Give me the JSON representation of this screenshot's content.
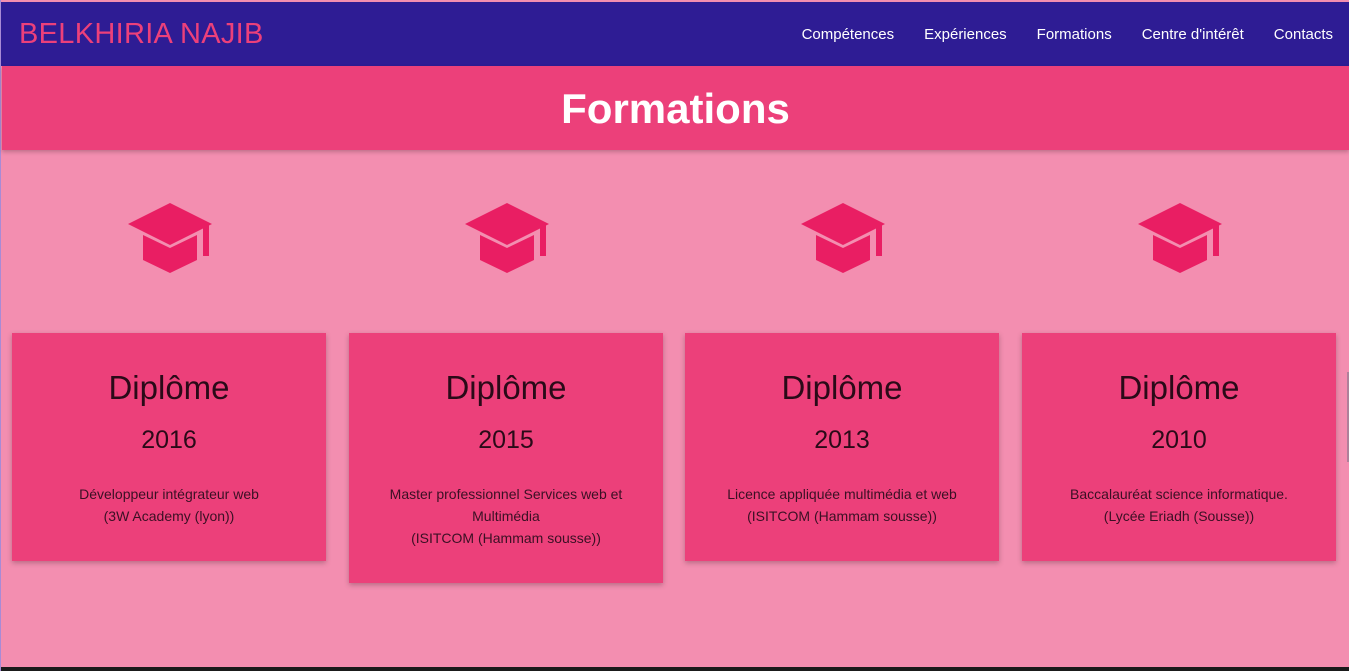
{
  "navbar": {
    "brand": "BELKHIRIA NAJIB",
    "links": [
      "Compétences",
      "Expériences",
      "Formations",
      "Centre d'intérêt",
      "Contacts"
    ]
  },
  "section": {
    "title": "Formations"
  },
  "cards": [
    {
      "title": "Diplôme",
      "year": "2016",
      "desc": "Développeur intégrateur web",
      "school": "(3W Academy (lyon))"
    },
    {
      "title": "Diplôme",
      "year": "2015",
      "desc": "Master professionnel Services web et Multimédia",
      "school": "(ISITCOM (Hammam sousse))"
    },
    {
      "title": "Diplôme",
      "year": "2013",
      "desc": "Licence appliquée multimédia et web",
      "school": "(ISITCOM (Hammam sousse))"
    },
    {
      "title": "Diplôme",
      "year": "2010",
      "desc": "Baccalauréat science informatique.",
      "school": "(Lycée Eriadh (Sousse))"
    }
  ],
  "icons": {
    "card_icon": "graduation-cap-icon"
  },
  "colors": {
    "navbar_bg": "#2e1c94",
    "brand": "#ec407a",
    "accent": "#ec407a",
    "page_bg": "#f38eb0",
    "icon": "#e91e63"
  }
}
